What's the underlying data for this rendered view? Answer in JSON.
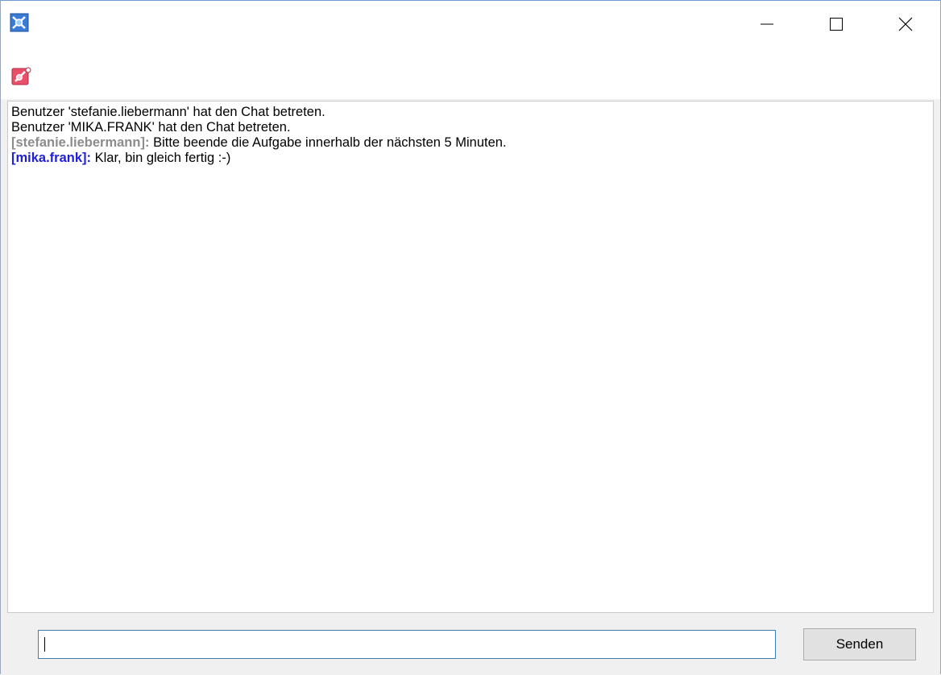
{
  "window": {
    "icons": {
      "app": "network-app-icon",
      "tool": "chat-tool-icon"
    },
    "controls": {
      "minimize": "minimize-icon",
      "maximize": "maximize-icon",
      "close": "close-icon"
    }
  },
  "chat": {
    "messages": [
      {
        "type": "system",
        "text": "Benutzer 'stefanie.liebermann' hat den Chat betreten."
      },
      {
        "type": "system",
        "text": "Benutzer 'MIKA.FRANK' hat den Chat betreten."
      },
      {
        "type": "user",
        "user": "[stefanie.liebermann]:",
        "text": "Bitte beende die Aufgabe innerhalb der nächsten 5 Minuten.",
        "color": "#8c8c8c"
      },
      {
        "type": "user",
        "user": "[mika.frank]:",
        "text": "Klar, bin gleich fertig :-)",
        "color": "#1f1fd6"
      }
    ]
  },
  "input": {
    "value": "",
    "placeholder": ""
  },
  "send_button": {
    "label": "Senden"
  }
}
